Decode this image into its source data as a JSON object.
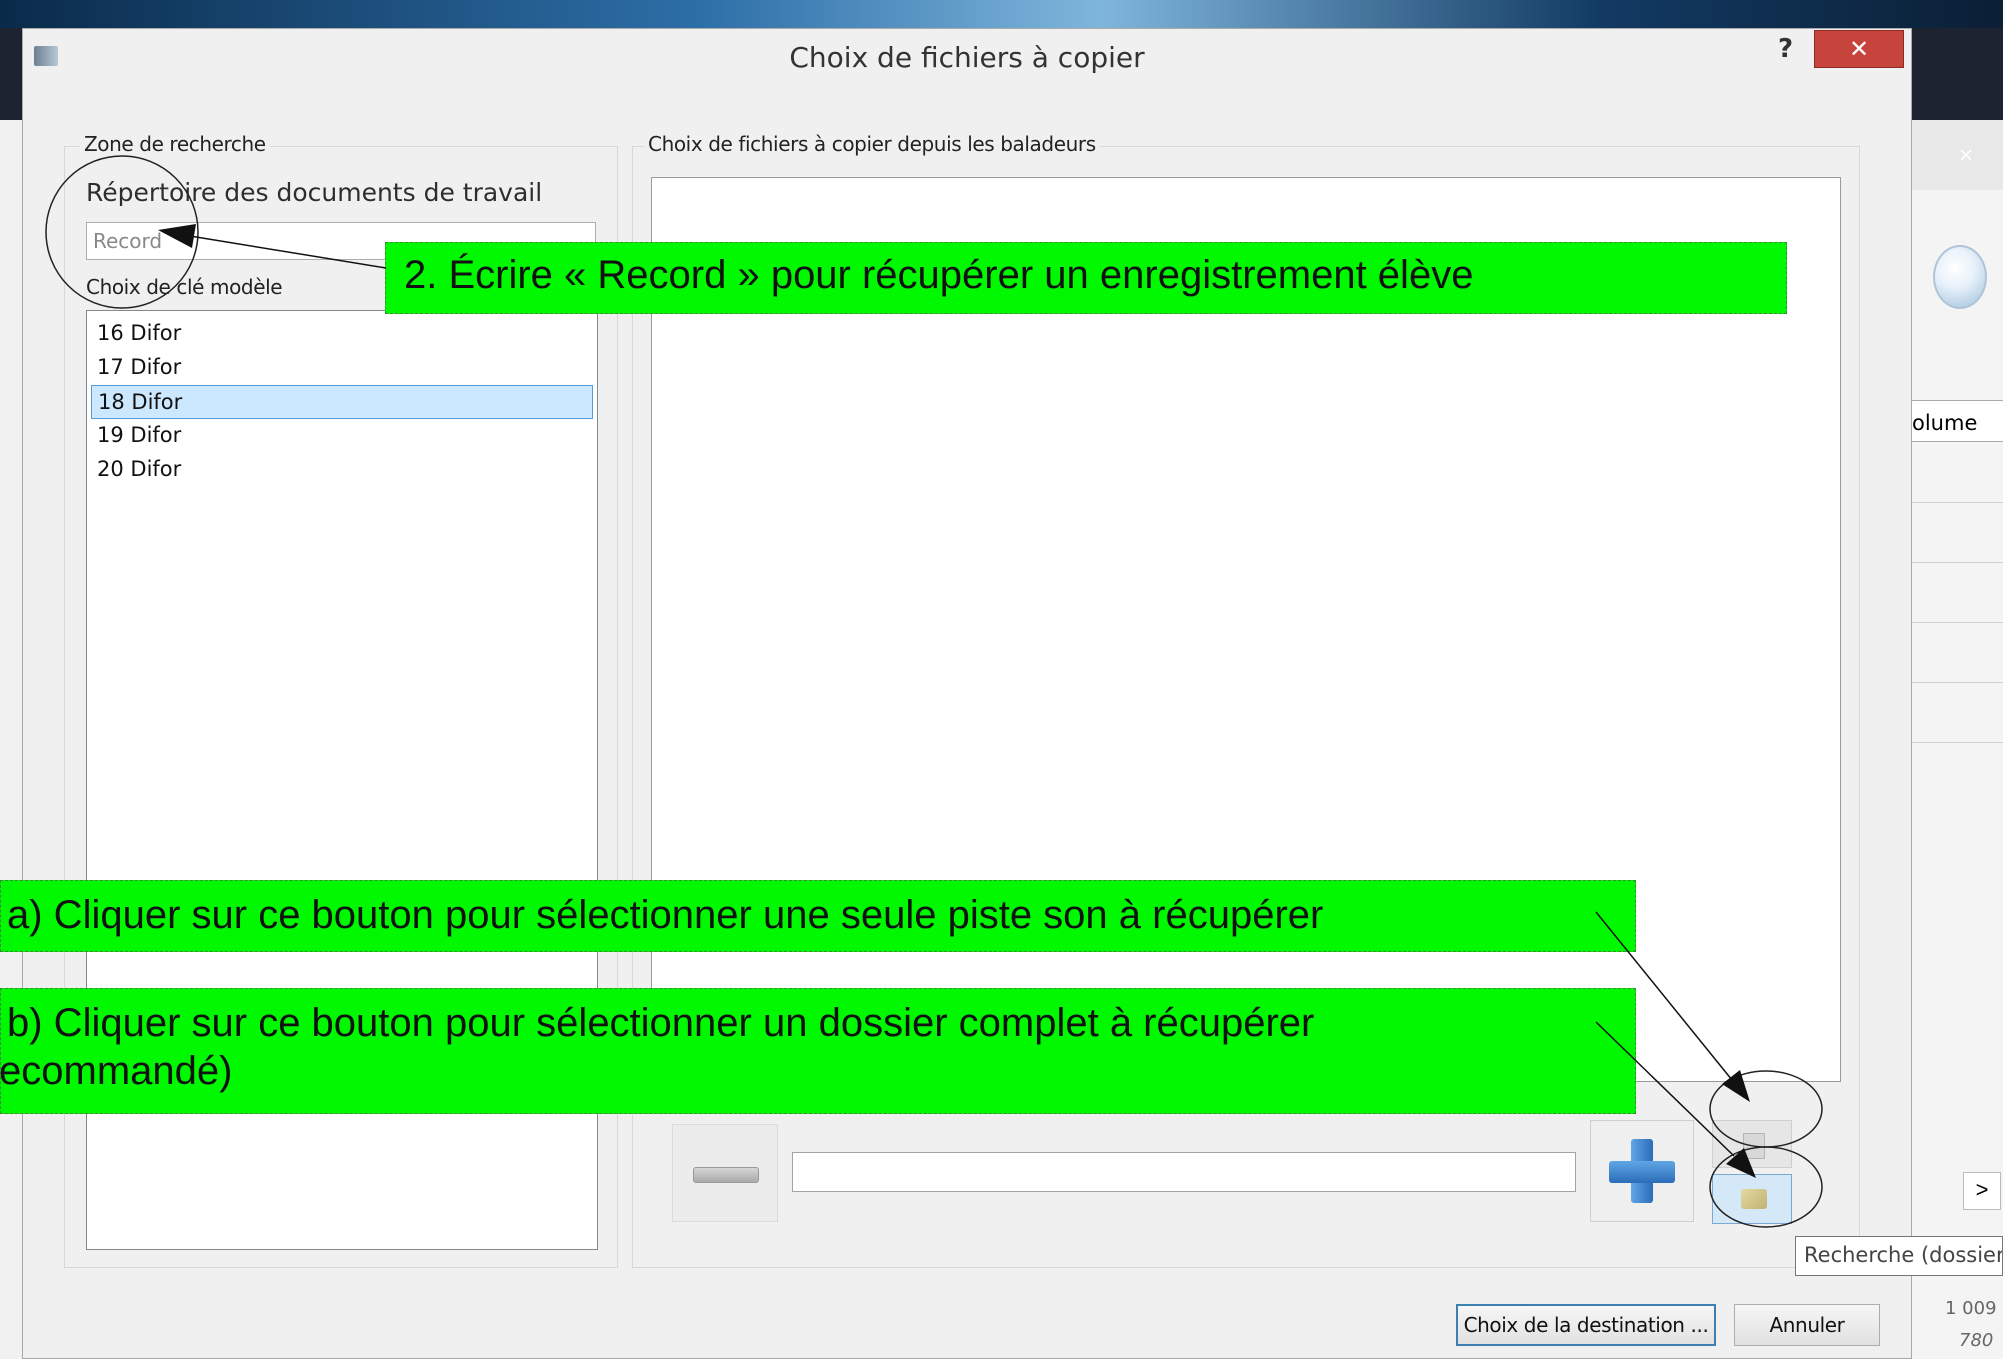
{
  "dialog": {
    "title": "Choix de fichiers à copier",
    "help": "?",
    "close": "✕"
  },
  "left_panel": {
    "group_label": "Zone de recherche",
    "dir_label": "Répertoire des documents de travail",
    "dir_value": "Record",
    "key_label": "Choix de clé modèle",
    "keys": [
      "16 Difor",
      "17 Difor",
      "18 Difor",
      "19 Difor",
      "20 Difor"
    ],
    "selected_key": "18 Difor"
  },
  "right_panel": {
    "group_label": "Choix de fichiers à copier depuis les baladeurs",
    "path_value": ""
  },
  "tooltip": "Recherche (dossier",
  "buttons": {
    "destination": "Choix de la destination ...",
    "cancel": "Annuler"
  },
  "background_window": {
    "close": "×",
    "column_header": "olume",
    "chevron": ">",
    "numbers": [
      "1 009",
      "780"
    ]
  },
  "annotations": {
    "step2": "2. Écrire « Record » pour récupérer un enregistrement élève",
    "step3a": "a) Cliquer sur ce bouton pour sélectionner une seule piste son à récupérer",
    "step3b_line1": "b) Cliquer sur ce bouton pour sélectionner un dossier complet à récupérer",
    "step3b_line2": "ecommandé)"
  },
  "colors": {
    "annotation_bg": "#00f800",
    "close_button": "#c7443d",
    "selection": "#cce8ff"
  }
}
